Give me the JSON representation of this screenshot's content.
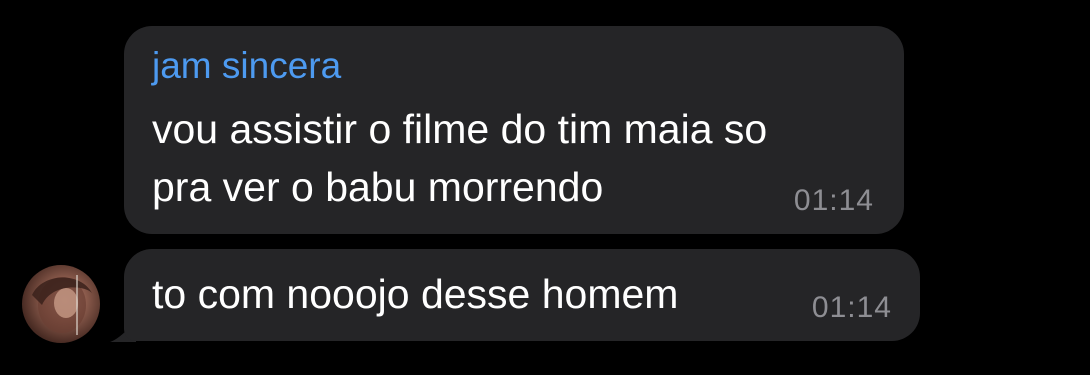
{
  "messages": [
    {
      "sender": "jam sincera",
      "lines": [
        "vou assistir o filme do tim maia so",
        "pra ver o babu morrendo"
      ],
      "time": "01:14"
    },
    {
      "text": "to com nooojo desse homem",
      "time": "01:14"
    }
  ],
  "colors": {
    "background": "#000000",
    "bubble": "#252527",
    "sender_name": "#4d9af0",
    "timestamp": "#8e8e93",
    "text": "#ffffff"
  },
  "icons": {
    "avatar": "user-avatar-photo"
  }
}
